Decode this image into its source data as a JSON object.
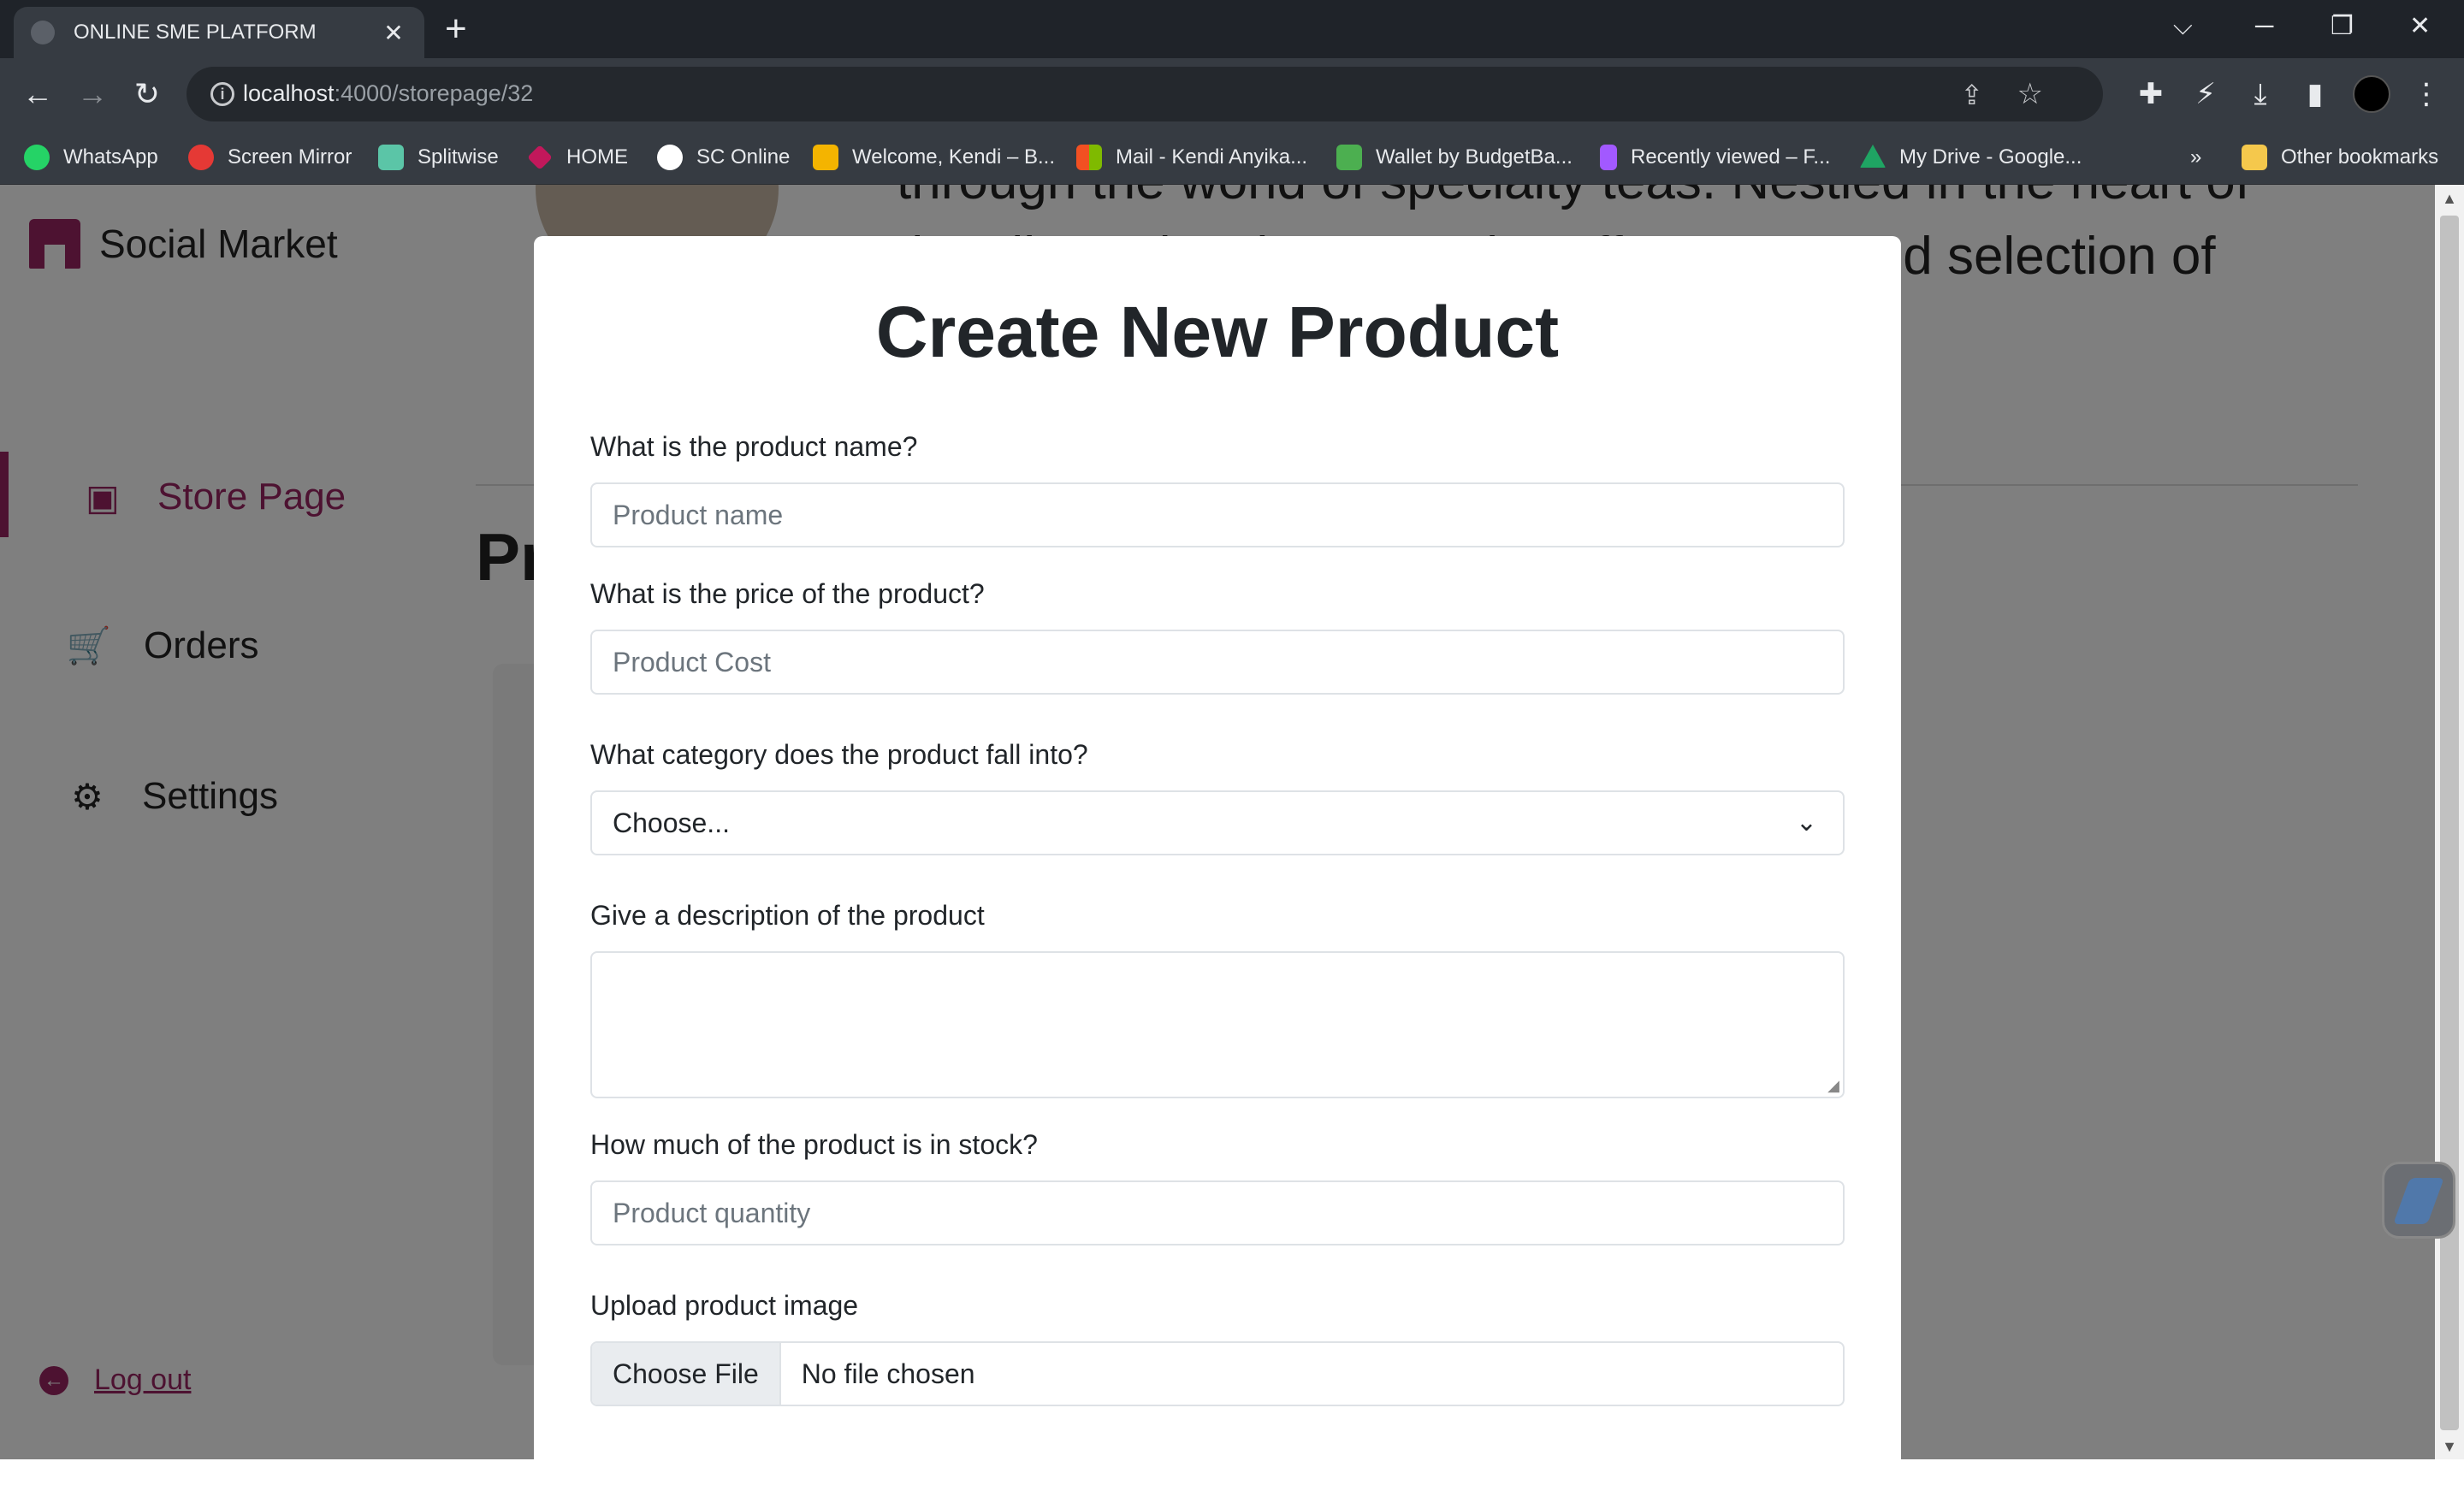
{
  "browser": {
    "tab_title": "ONLINE SME PLATFORM",
    "url_host": "localhost",
    "url_path": ":4000/storepage/32",
    "bookmarks": [
      {
        "label": "WhatsApp",
        "color": "#25d366"
      },
      {
        "label": "Screen Mirror",
        "color": "#e53935"
      },
      {
        "label": "Splitwise",
        "color": "#5bc5a7"
      },
      {
        "label": "HOME",
        "color": "#c2185b"
      },
      {
        "label": "SC Online",
        "color": "#ffffff"
      },
      {
        "label": "Welcome, Kendi – B...",
        "color": "#f4b400"
      },
      {
        "label": "Mail - Kendi Anyika...",
        "color": "#f25022"
      },
      {
        "label": "Wallet by BudgetBa...",
        "color": "#4caf50"
      },
      {
        "label": "Recently viewed – F...",
        "color": "#a259ff"
      },
      {
        "label": "My Drive - Google...",
        "color": "#1fa463"
      }
    ],
    "bookmarks_more": "»",
    "other_bookmarks": "Other bookmarks"
  },
  "sidebar": {
    "brand": "Social Market",
    "items": [
      {
        "label": "Store Page",
        "icon": "store-icon"
      },
      {
        "label": "Orders",
        "icon": "cart-icon"
      },
      {
        "label": "Settings",
        "icon": "gear-icon"
      }
    ],
    "logout": "Log out"
  },
  "background": {
    "line1": "through the world of specialty teas. Nestled in the heart of",
    "line2": "the vibrant local community, offers a curated selection of",
    "heading": "Pr"
  },
  "modal": {
    "title": "Create New Product",
    "fields": {
      "name_label": "What is the product name?",
      "name_placeholder": "Product name",
      "price_label": "What is the price of the product?",
      "price_placeholder": "Product Cost",
      "category_label": "What category does the product fall into?",
      "category_value": "Choose...",
      "description_label": "Give a description of the product",
      "stock_label": "How much of the product is in stock?",
      "stock_placeholder": "Product quantity",
      "image_label": "Upload product image",
      "file_button": "Choose File",
      "file_status": "No file chosen"
    }
  },
  "colors": {
    "accent": "#9b2463",
    "chrome_dark": "#1f2329",
    "chrome": "#363b42"
  }
}
